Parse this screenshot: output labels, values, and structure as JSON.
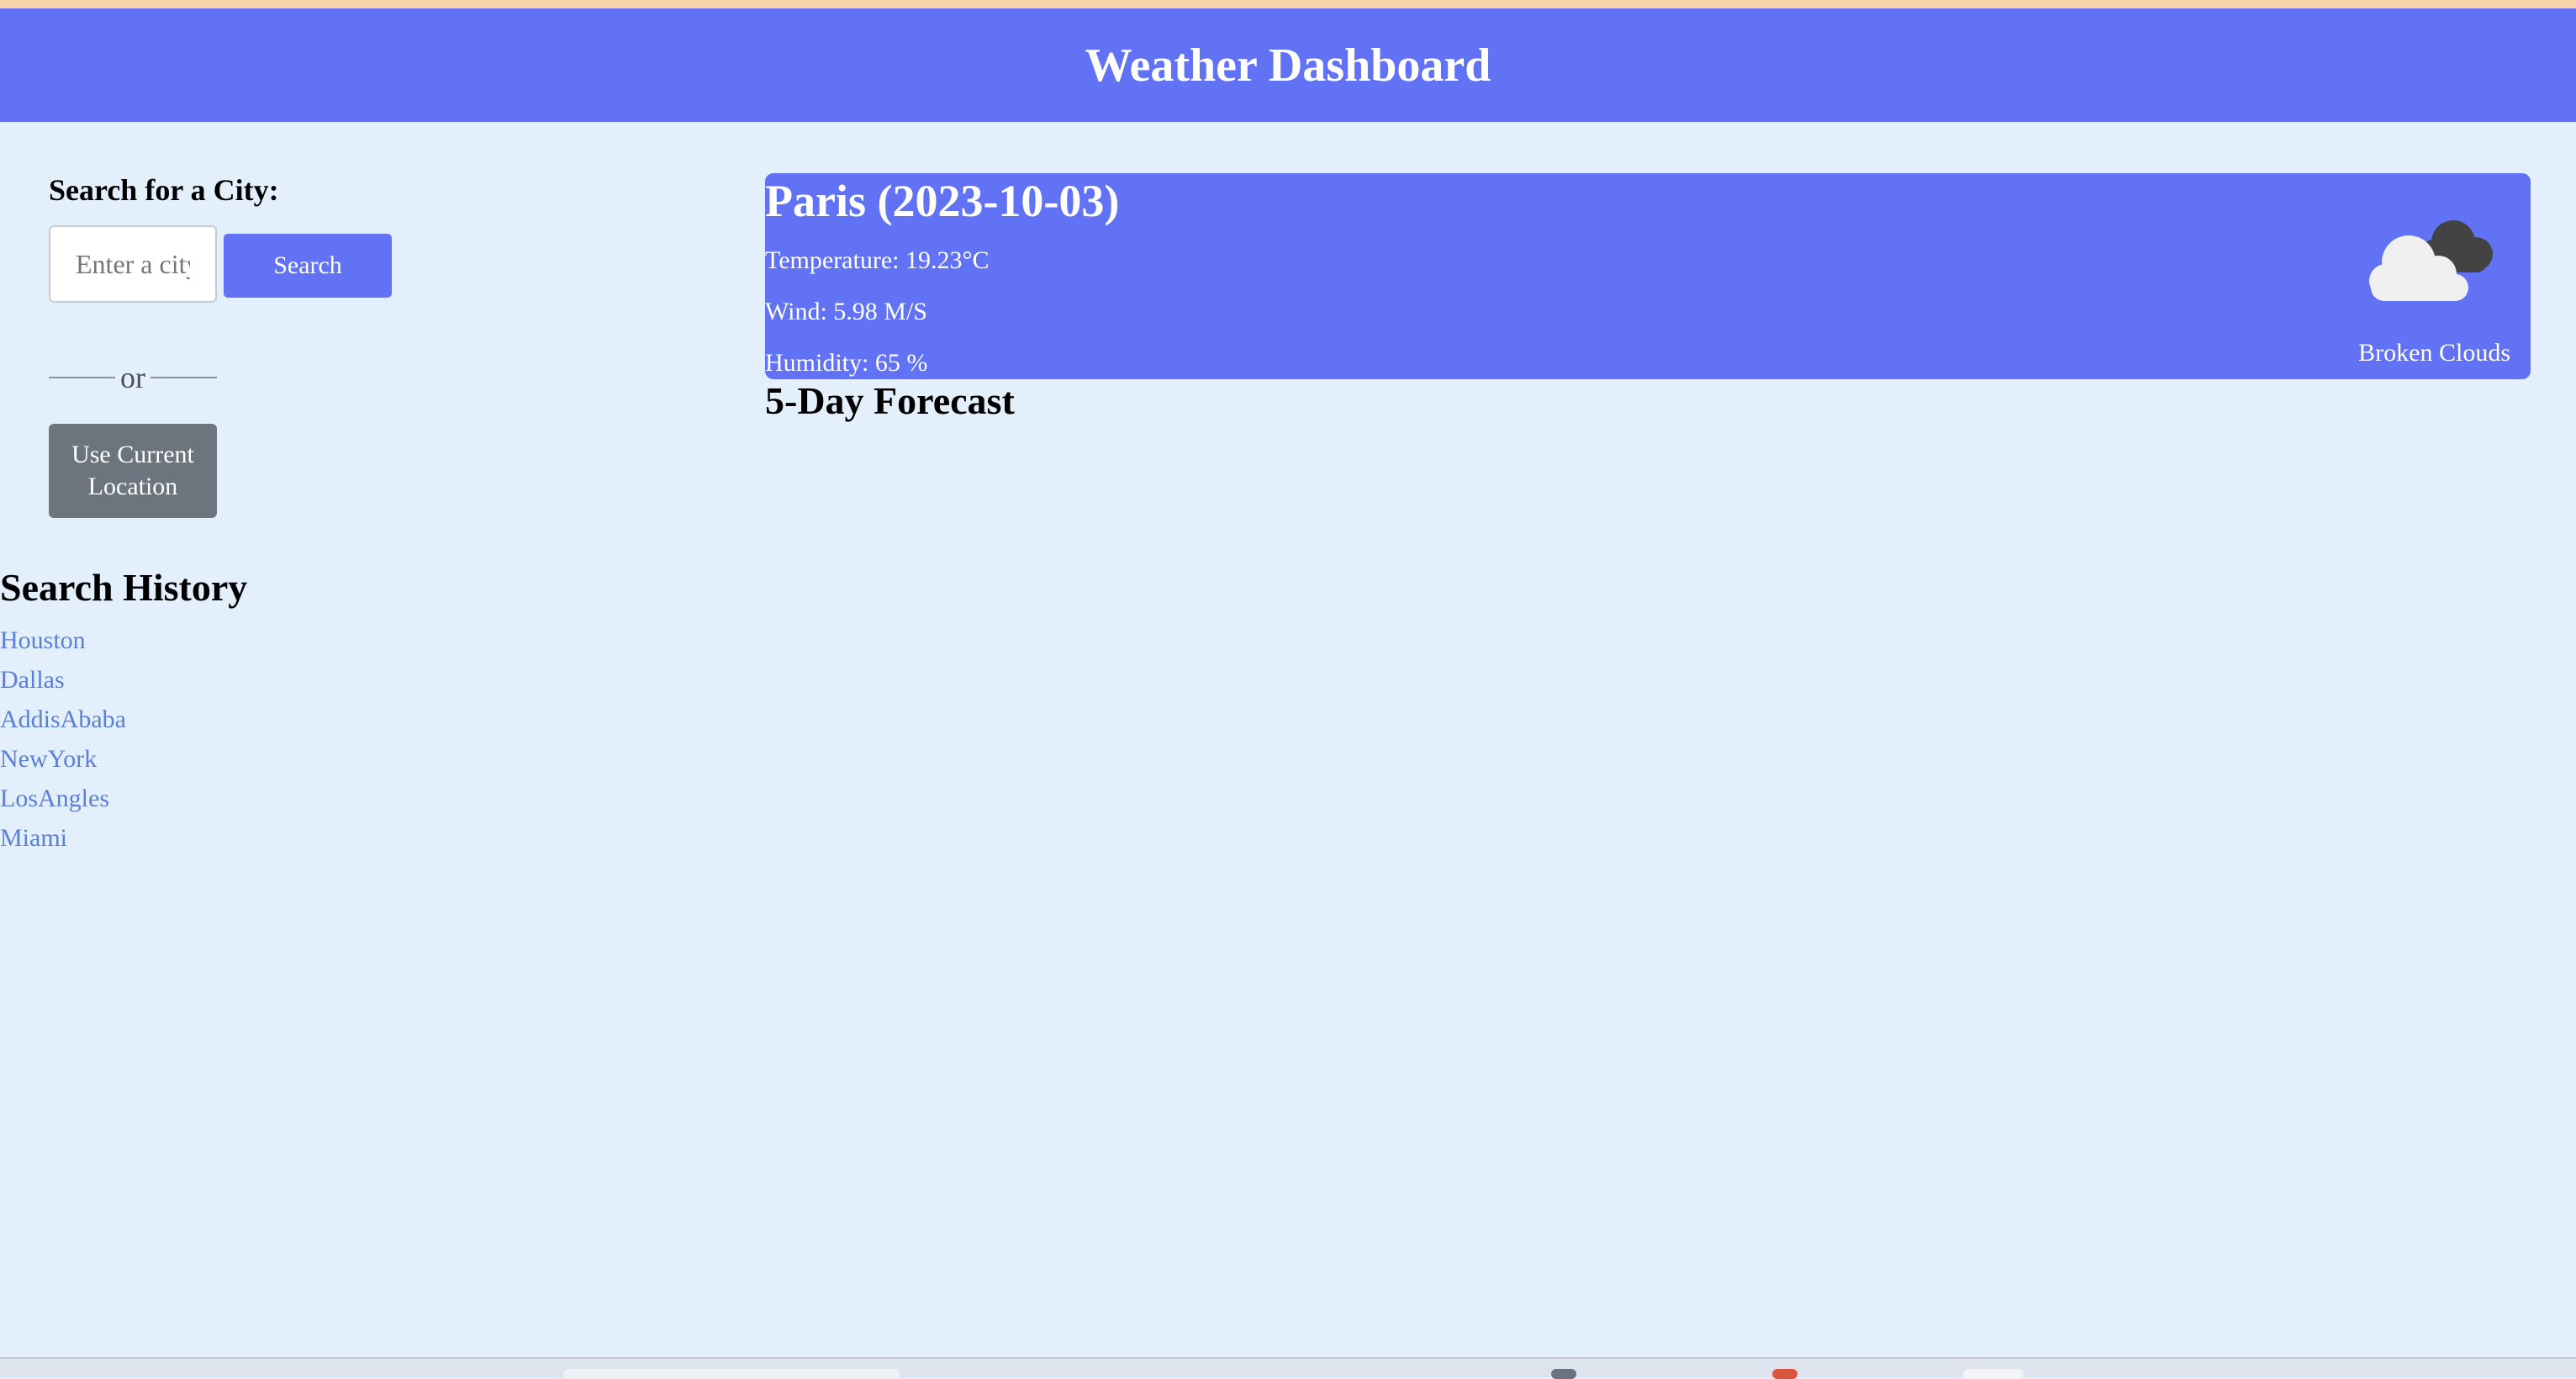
{
  "header": {
    "title": "Weather Dashboard"
  },
  "search": {
    "label": "Search for a City:",
    "placeholder": "Enter a city",
    "button_label": "Search",
    "divider_text": "or",
    "location_button_label": "Use Current Location"
  },
  "history": {
    "title": "Search History",
    "items": [
      "Houston",
      "Dallas",
      "AddisAbaba",
      "NewYork",
      "LosAngles",
      "Miami"
    ]
  },
  "current": {
    "city_date": "Paris (2023-10-03)",
    "temperature": "Temperature: 19.23°C",
    "wind": "Wind: 5.98 M/S",
    "humidity": "Humidity: 65 %",
    "description": "Broken Clouds",
    "icon": "broken-clouds-icon"
  },
  "forecast": {
    "title": "5-Day Forecast"
  },
  "colors": {
    "accent": "#6173f4",
    "background": "#e3f0fc",
    "secondary_button": "#6c757d",
    "link": "#5a7fd6"
  }
}
